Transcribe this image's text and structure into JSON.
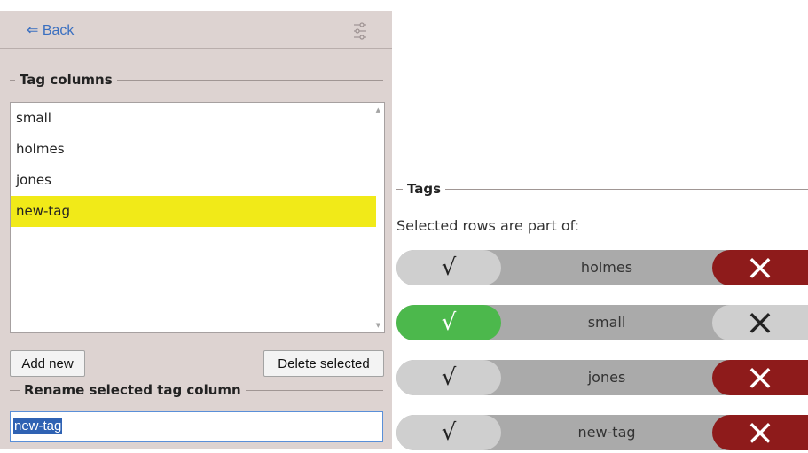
{
  "left": {
    "back_label": "⇐ Back",
    "tag_columns_title": "Tag columns",
    "list_items": [
      {
        "label": "small",
        "selected": false
      },
      {
        "label": "holmes",
        "selected": false
      },
      {
        "label": "jones",
        "selected": false
      },
      {
        "label": "new-tag",
        "selected": true
      }
    ],
    "add_new_label": "Add new",
    "delete_selected_label": "Delete selected",
    "rename_title": "Rename selected tag column",
    "rename_value": "new-tag"
  },
  "right": {
    "tags_title": "Tags",
    "subtitle": "Selected rows are part of:",
    "check_glyph": "√",
    "cross_glyph": "×",
    "rows": [
      {
        "name": "holmes",
        "state": "excluded"
      },
      {
        "name": "small",
        "state": "included"
      },
      {
        "name": "jones",
        "state": "excluded"
      },
      {
        "name": "new-tag",
        "state": "excluded"
      }
    ]
  },
  "colors": {
    "panel_bg": "#ddd3d1",
    "link": "#3a6fc0",
    "selected_row": "#f1ea18",
    "included_green": "#4cb84c",
    "excluded_red": "#8e1b1b",
    "neutral_pill": "#cfcfcf",
    "track": "#aaaaaa"
  }
}
